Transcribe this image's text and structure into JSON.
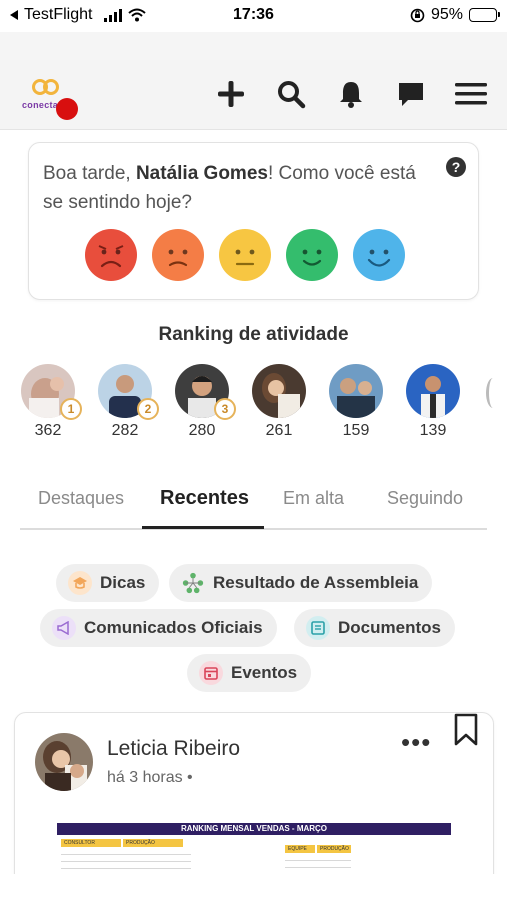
{
  "status_bar": {
    "back_app": "TestFlight",
    "time": "17:36",
    "battery": "95%",
    "battery_level": 0.95
  },
  "header": {
    "logo_text": "conecta",
    "actions": [
      {
        "name": "add-button",
        "icon": "plus-icon"
      },
      {
        "name": "search-button",
        "icon": "search-icon"
      },
      {
        "name": "notifications-button",
        "icon": "bell-icon"
      },
      {
        "name": "messages-button",
        "icon": "chat-bubble-icon"
      },
      {
        "name": "menu-button",
        "icon": "hamburger-menu-icon"
      }
    ],
    "colors": {
      "logo_ring": "#f2b43c",
      "logo_text": "#7b3aa6",
      "notification_dot": "#d80f0f"
    }
  },
  "mood": {
    "greeting_pre": "Boa tarde, ",
    "user_name": "Natália Gomes",
    "greeting_post": "! Como você está se sentindo hoje?",
    "help_label": "?",
    "faces": [
      {
        "name": "mood-very-sad",
        "color": "#e84e3c"
      },
      {
        "name": "mood-sad",
        "color": "#f47d46"
      },
      {
        "name": "mood-neutral",
        "color": "#f7c642"
      },
      {
        "name": "mood-happy",
        "color": "#34bd6d"
      },
      {
        "name": "mood-very-happy",
        "color": "#4fb4ea"
      }
    ]
  },
  "ranking": {
    "title": "Ranking de atividade",
    "entries": [
      {
        "score": "362",
        "medal": "1"
      },
      {
        "score": "282",
        "medal": "2"
      },
      {
        "score": "280",
        "medal": "3"
      },
      {
        "score": "261",
        "medal": ""
      },
      {
        "score": "159",
        "medal": ""
      },
      {
        "score": "139",
        "medal": ""
      }
    ]
  },
  "tabs": [
    {
      "label": "Destaques",
      "active": false
    },
    {
      "label": "Recentes",
      "active": true
    },
    {
      "label": "Em alta",
      "active": false
    },
    {
      "label": "Seguindo",
      "active": false
    }
  ],
  "categories": [
    {
      "label": "Dicas",
      "icon": "graduation-cap-icon",
      "color": "#f2a65a"
    },
    {
      "label": "Resultado de Assembleia",
      "icon": "network-people-icon",
      "color": "#5fb36a"
    },
    {
      "label": "Comunicados Oficiais",
      "icon": "megaphone-icon",
      "color": "#9a6bd1"
    },
    {
      "label": "Documentos",
      "icon": "document-icon",
      "color": "#2aa0a8"
    },
    {
      "label": "Eventos",
      "icon": "calendar-icon",
      "color": "#d9455a"
    }
  ],
  "post": {
    "author": "Leticia Ribeiro",
    "time": "há 3 horas •",
    "more_label": "•••",
    "image_title": "RANKING MENSAL VENDAS - MARÇO",
    "sheet_headers": [
      "CONSULTOR",
      "PRODUÇÃO",
      "EQUIPE",
      "PRODUÇÃO"
    ]
  }
}
